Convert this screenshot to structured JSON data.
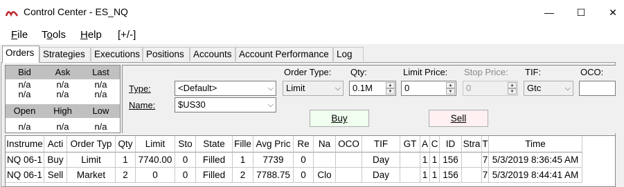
{
  "window": {
    "title": "Control Center - ES_NQ",
    "icon": "ninja-icon",
    "controls": {
      "minimize": "—",
      "maximize": "☐",
      "close": "✕"
    }
  },
  "menu": [
    {
      "label_u": "F",
      "label_rest": "ile"
    },
    {
      "label_pre": "T",
      "label_u": "o",
      "label_rest": "ols"
    },
    {
      "label_u": "H",
      "label_rest": "elp"
    },
    {
      "label": "[+/-]"
    }
  ],
  "tabs": [
    "Orders",
    "Strategies",
    "Executions",
    "Positions",
    "Accounts",
    "Account Performance",
    "Log"
  ],
  "active_tab": "Orders",
  "quote": {
    "headers1": [
      "Bid",
      "Ask",
      "Last"
    ],
    "row1a": [
      "n/a",
      "n/a",
      "n/a"
    ],
    "row1b": [
      "n/a",
      "n/a",
      "n/a"
    ],
    "headers2": [
      "Open",
      "High",
      "Low"
    ],
    "row2": [
      "n/a",
      "n/a",
      "n/a"
    ]
  },
  "order": {
    "type_label": "Type:",
    "type_value": "<Default>",
    "name_label": "Name:",
    "name_value": "$US30",
    "order_type_label": "Order Type:",
    "order_type_value": "Limit",
    "qty_label": "Qty:",
    "qty_value": "0.1M",
    "limit_price_label": "Limit Price:",
    "limit_price_value": "0",
    "stop_price_label": "Stop Price:",
    "stop_price_value": "0",
    "tif_label": "TIF:",
    "tif_value": "Gtc",
    "oco_label": "OCO:",
    "oco_value": "",
    "buy_label": "Buy",
    "sell_label": "Sell",
    "buy_color": "#f0fff0",
    "sell_color": "#fff0f2"
  },
  "grid": {
    "columns": [
      "Instrume",
      "Acti",
      "Order Typ",
      "Qty",
      "Limit",
      "Sto",
      "State",
      "Fille",
      "Avg Pric",
      "Re",
      "Na",
      "OCO",
      "TIF",
      "GT",
      "A",
      "C",
      "ID",
      "Stra",
      "T",
      "Time"
    ],
    "rows": [
      [
        "NQ 06-1",
        "Buy",
        "Limit",
        "1",
        "7740.00",
        "0",
        "Filled",
        "1",
        "7739",
        "0",
        "",
        "",
        "Day",
        "",
        "1",
        "1",
        "156",
        "",
        "7",
        "5/3/2019 8:36:45 AM"
      ],
      [
        "NQ 06-1",
        "Sell",
        "Market",
        "2",
        "0",
        "0",
        "Filled",
        "2",
        "7788.75",
        "0",
        "Clo",
        "",
        "Day",
        "",
        "1",
        "1",
        "156",
        "",
        "7",
        "5/3/2019 8:44:41 AM"
      ]
    ]
  }
}
